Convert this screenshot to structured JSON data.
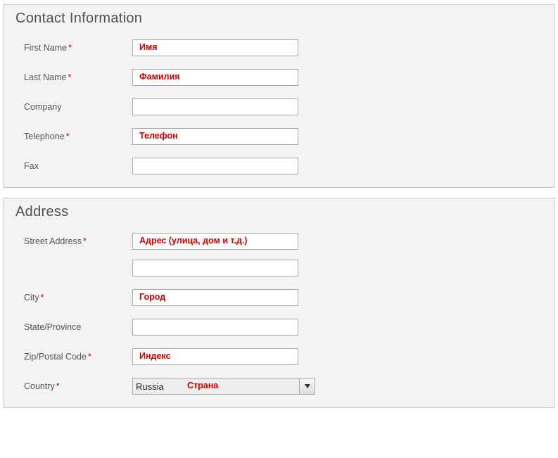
{
  "contact": {
    "legend": "Contact Information",
    "first_name_label": "First Name",
    "first_name_value": "",
    "first_name_annotation": "Имя",
    "last_name_label": "Last Name",
    "last_name_value": "",
    "last_name_annotation": "Фамилия",
    "company_label": "Company",
    "company_value": "",
    "telephone_label": "Telephone",
    "telephone_value": "",
    "telephone_annotation": "Телефон",
    "fax_label": "Fax",
    "fax_value": ""
  },
  "address": {
    "legend": "Address",
    "street_label": "Street Address",
    "street_value": "",
    "street_annotation": "Адрес (улица, дом и т.д.)",
    "street2_value": "",
    "city_label": "City",
    "city_value": "",
    "city_annotation": "Город",
    "state_label": "State/Province",
    "state_value": "",
    "zip_label": "Zip/Postal Code",
    "zip_value": "",
    "zip_annotation": "Индекс",
    "country_label": "Country",
    "country_selected": "Russia",
    "country_annotation": "Страна"
  },
  "required_marker": "*"
}
